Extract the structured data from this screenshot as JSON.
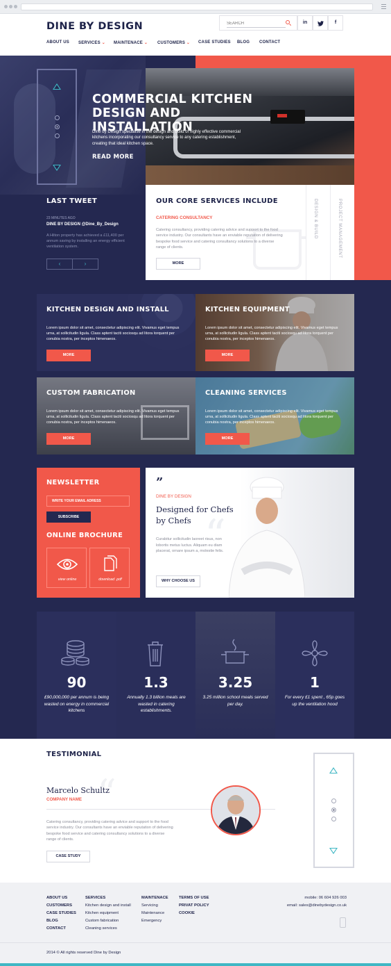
{
  "brand": {
    "logo": "DINE BY DESIGN",
    "accent": "#f1584a",
    "navy": "#242850",
    "teal": "#3fb7c4"
  },
  "header": {
    "search_placeholder": "SEARCH",
    "social": [
      "in",
      "t",
      "f"
    ],
    "nav": [
      "ABOUT US",
      "SERVICES",
      "MAINTENACE",
      "CUSTOMERS",
      "CASE STUDIES",
      "BLOG",
      "CONTACT"
    ]
  },
  "hero": {
    "title_line1": "COMMERCIAL KITCHEN",
    "title_line2": "DESIGN AND INSTALLATION",
    "body": "Dine by Design specialise in the design and build of highly effective commercial kitchens incorporating our consultancy service to any catering establishment, creating that ideal kitchen space.",
    "cta": "READ MORE"
  },
  "tweet": {
    "title": "LAST TWEET",
    "time": "23 MINUTES AGO",
    "user": "DINE BY DESIGN @Dine_By_Design",
    "body": "A Hilton property has achieved a £11,400 per annum saving by installing an energy efficient ventilation system.",
    "prev": "‹",
    "next": "›"
  },
  "core_services": {
    "title": "OUR CORE SERVICES INCLUDE",
    "subtitle": "CATERING CONSULTANCY",
    "body": "Catering consultancy, providing catering advice and support to the food service industry. Our consultants have an enviable reputation of delivering bespoke food service and catering consultancy solutions to a diverse range of clients.",
    "more": "MORE",
    "tabs": [
      "DESIGN & BUILD",
      "PROJECT MANAGEMENT"
    ]
  },
  "tiles": [
    {
      "title": "KITCHEN DESIGN AND INSTALL",
      "body": "Lorem ipsum dolor sit amet, consectetur adipiscing elit. Vivamus eget tempus urna, at sollicitudin ligula. Class aptent taciti sociosqu ad litora torquent per conubia nostra, per inceptos himenaeos.",
      "more": "MORE"
    },
    {
      "title": "KITCHEN EQUIPMENT",
      "body": "Lorem ipsum dolor sit amet, consectetur adipiscing elit. Vivamus eget tempus urna, at sollicitudin ligula. Class aptent taciti sociosqu ad litora torquent per conubia nostra, per inceptos himenaeos.",
      "more": "MORE"
    },
    {
      "title": "CUSTOM FABRICATION",
      "body": "Lorem ipsum dolor sit amet, consectetur adipiscing elit. Vivamus eget tempus urna, at sollicitudin ligula. Class aptent taciti sociosqu ad litora torquent per conubia nostra, per inceptos himenaeos.",
      "more": "MORE"
    },
    {
      "title": "CLEANING SERVICES",
      "body": "Lorem ipsum dolor sit amet, consectetur adipiscing elit. Vivamus eget tempus urna, at sollicitudin ligula. Class aptent taciti sociosqu ad litora torquent per conubia nostra, per inceptos himenaeos.",
      "more": "MORE"
    }
  ],
  "newsletter": {
    "title": "NEWSLETTER",
    "email_placeholder": "WRITE YOUR EMAIL ADRESS",
    "subscribe": "SUBSCRIBE",
    "brochure_title": "ONLINE BROCHURE",
    "view": "view online",
    "download": "download .pdf"
  },
  "designed": {
    "quote_mark": "”",
    "label": "DINE BY DESIGN",
    "heading_line1": "Designed for Chefs",
    "heading_line2": "by Chefs",
    "body": "Curabitur sollicitudin laoreet risus, non lobortis metus luctus. Aliquam eu diam placerat, ornare ipsum a, molestie felis.",
    "cta": "WHY CHOOSE US"
  },
  "stats": [
    {
      "icon": "coins-icon",
      "value": "90",
      "text": "£90,000,000 per annum is being wasted on energy in commercial kitchens"
    },
    {
      "icon": "trash-icon",
      "value": "1.3",
      "text": "Annually 1.3 billion meals are wasted in catering establishments."
    },
    {
      "icon": "pot-icon",
      "value": "3.25",
      "text": "3.25 million school meals served per day."
    },
    {
      "icon": "fan-icon",
      "value": "1",
      "text": "For every £1 spent , 65p goes up the ventilation hood"
    }
  ],
  "testimonial": {
    "title": "TESTIMONIAL",
    "name": "Marcelo Schultz",
    "company": "COMPANY NAME",
    "body": "Catering consultancy, providing catering advice and support to the food service industry. Our consultants have an enviable reputation of delivering bespoke food service and catering consultancy solutions to a diverse range of clients.",
    "cta": "CASE STUDY"
  },
  "footer": {
    "col1": [
      "ABOUT US",
      "CUSTOMERS",
      "CASE STUDIES",
      "BLOG",
      "CONTACT"
    ],
    "col2_title": "SERVICES",
    "col2": [
      "Kitchen design and install",
      "Kitchen equipment",
      "Custom fabrication",
      "Cleaning services"
    ],
    "col3_title": "MAINTENACE",
    "col3": [
      "Servicing",
      "Maintenance",
      "Emergency"
    ],
    "col4": [
      "TERMS OF USE",
      "PRIVAT POLICY",
      "COOKIE"
    ],
    "mobile": "mobile: 06 604 926 003",
    "email": "email: sales@dinebydesign.co.uk",
    "copyright": "2014 © All rights reserved Dine by Design"
  }
}
